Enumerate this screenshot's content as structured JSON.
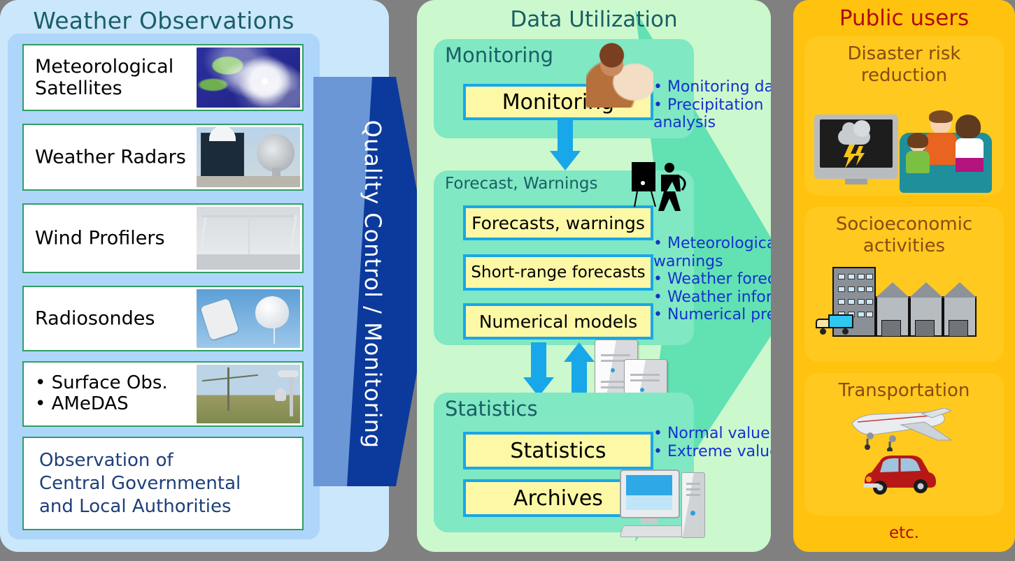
{
  "left": {
    "title": "Weather Observations",
    "items": [
      {
        "label": "Meteorological\nSatellites",
        "icon": "satellite-typhoon-image"
      },
      {
        "label": "Weather Radars",
        "icon": "radar-dome-image"
      },
      {
        "label": "Wind Profilers",
        "icon": "wind-profiler-image"
      },
      {
        "label": "Radiosondes",
        "icon": "radiosonde-balloon-image"
      },
      {
        "label": "• Surface Obs.\n• AMeDAS",
        "icon": "surface-station-image"
      }
    ],
    "footer": "Observation of\n Central Governmental\n and Local Authorities"
  },
  "connector": {
    "label": "Quality Control / Monitoring",
    "body_color": "#6b97d7",
    "head_color": "#0c3a9c"
  },
  "center": {
    "title": "Data Utilization",
    "sections": [
      {
        "name": "monitoring",
        "title": "Monitoring",
        "boxes": [
          {
            "label": "Monitoring",
            "size": "large"
          }
        ],
        "bullets": [
          "Monitoring data",
          "Precipitation analysis"
        ],
        "icon": "seated-person-icon"
      },
      {
        "name": "forecast-warnings",
        "title": "Forecast, Warnings",
        "boxes": [
          {
            "label": "Forecasts, warnings",
            "size": "medium"
          },
          {
            "label": "Short-range forecasts",
            "size": "small"
          },
          {
            "label": "Numerical models",
            "size": "medium"
          }
        ],
        "bullets": [
          "Meteorological warnings",
          "Weather forecasts",
          "Weather information",
          "Numerical prediction"
        ],
        "icon": "presenter-whiteboard-icon"
      },
      {
        "name": "statistics",
        "title": "Statistics",
        "boxes": [
          {
            "label": "Statistics",
            "size": "large"
          },
          {
            "label": "Archives",
            "size": "large"
          }
        ],
        "bullets": [
          "Normal values",
          "Extreme values"
        ],
        "icon": "desktop-computer-icon"
      }
    ],
    "server_icon": "server-rack-icon",
    "box_fill": "#fdf8a6",
    "box_border": "#18a7e8",
    "bullet_color": "#1431cf"
  },
  "right": {
    "title": "Public users",
    "cards": [
      {
        "title": "Disaster risk\nreduction",
        "icon": "family-watching-tv-icon"
      },
      {
        "title": "Socioeconomic\nactivities",
        "icon": "factory-building-truck-icon"
      },
      {
        "title": "Transportation",
        "icon": "airplane-car-icon"
      }
    ],
    "footer": "etc.",
    "panel_color": "#ffc20e",
    "title_color": "#b00d0d"
  }
}
